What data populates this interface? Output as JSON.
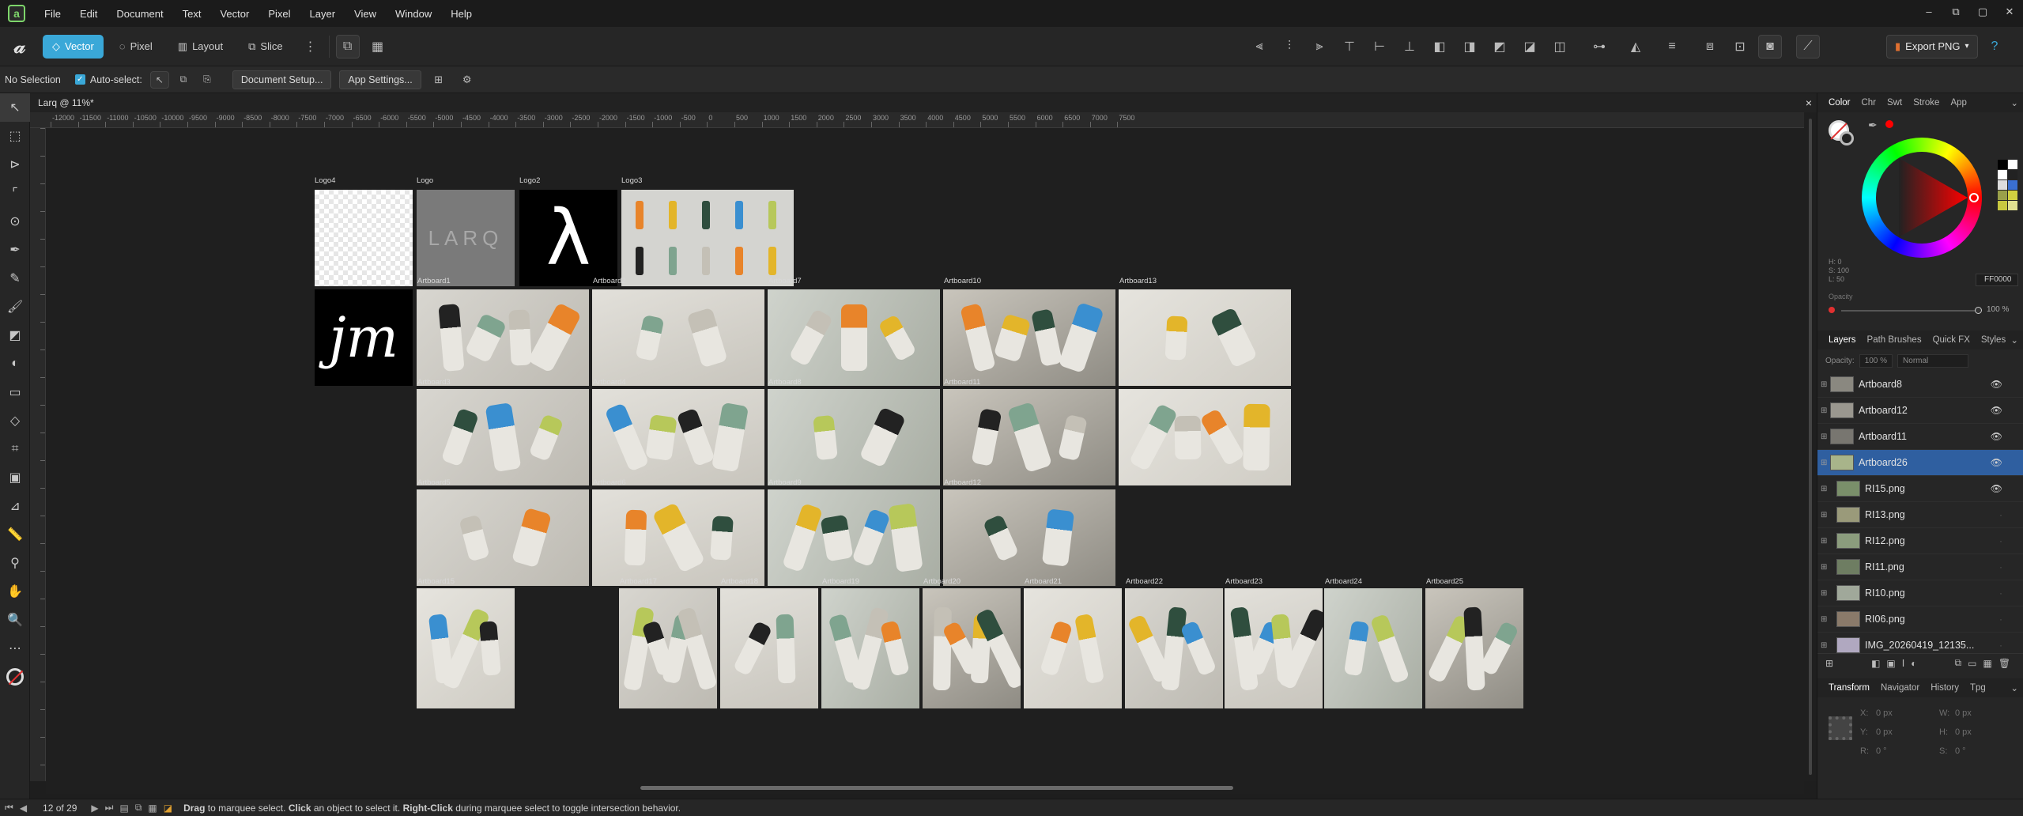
{
  "app": {
    "icon_letter": "a"
  },
  "menu": [
    "File",
    "Edit",
    "Document",
    "Text",
    "Vector",
    "Pixel",
    "Layer",
    "View",
    "Window",
    "Help"
  ],
  "window_controls": [
    "–",
    "⧉",
    "▢",
    "✕"
  ],
  "toolbar": {
    "personas": [
      {
        "label": "Vector",
        "active": true,
        "icon": "vector-persona-icon"
      },
      {
        "label": "Pixel",
        "active": false,
        "icon": "pixel-persona-icon"
      },
      {
        "label": "Layout",
        "active": false,
        "icon": "layout-persona-icon"
      },
      {
        "label": "Slice",
        "active": false,
        "icon": "slice-persona-icon"
      }
    ],
    "more": "⋮",
    "export_label": "Export PNG"
  },
  "context": {
    "selection": "No Selection",
    "autoselect_label": "Auto-select:",
    "document_setup": "Document Setup...",
    "app_settings": "App Settings..."
  },
  "document": {
    "tab_title": "Larq @ 11%*",
    "close": "×"
  },
  "ruler": {
    "h_labels": [
      "-12000",
      "-11500",
      "-11000",
      "-10500",
      "-10000",
      "-9500",
      "-9000",
      "-8500",
      "-8000",
      "-7500",
      "-7000",
      "-6500",
      "-6000",
      "-5500",
      "-5000",
      "-4500",
      "-4000",
      "-3500",
      "-3000",
      "-2500",
      "-2000",
      "-1500",
      "-1000",
      "-500",
      "0",
      "500",
      "1000",
      "1500",
      "2000",
      "2500",
      "3000",
      "3500",
      "4000",
      "4500",
      "5000",
      "5500",
      "6000",
      "6500",
      "7000",
      "7500"
    ]
  },
  "artboards": [
    {
      "label": "Logo4",
      "kind": "checker"
    },
    {
      "label": "Logo",
      "kind": "larq",
      "text": "LARQ"
    },
    {
      "label": "Logo2",
      "kind": "lambda",
      "text": "λ"
    },
    {
      "label": "Logo3",
      "kind": "grid"
    },
    {
      "label": "",
      "kind": "jm",
      "text": "jm"
    },
    {
      "label": "Artboard1",
      "kind": "photo"
    },
    {
      "label": "Artboard2",
      "kind": "photo"
    },
    {
      "label": "Artboard7",
      "kind": "photo"
    },
    {
      "label": "Artboard10",
      "kind": "photo"
    },
    {
      "label": "Artboard13",
      "kind": "photo"
    },
    {
      "label": "Artboard3",
      "kind": "photo"
    },
    {
      "label": "Artboard4",
      "kind": "photo"
    },
    {
      "label": "Artboard8",
      "kind": "photo"
    },
    {
      "label": "Artboard11",
      "kind": "photo"
    },
    {
      "label": "Artboard26",
      "kind": "photo"
    },
    {
      "label": "Artboard5",
      "kind": "photo"
    },
    {
      "label": "Artboard6",
      "kind": "photo"
    },
    {
      "label": "Artboard9",
      "kind": "photo"
    },
    {
      "label": "Artboard12",
      "kind": "photo"
    },
    {
      "label": "Artboard15",
      "kind": "photo"
    },
    {
      "label": "Artboard17",
      "kind": "photo"
    },
    {
      "label": "Artboard18",
      "kind": "photo"
    },
    {
      "label": "Artboard19",
      "kind": "photo"
    },
    {
      "label": "Artboard20",
      "kind": "photo"
    },
    {
      "label": "Artboard21",
      "kind": "photo"
    },
    {
      "label": "Artboard22",
      "kind": "photo"
    },
    {
      "label": "Artboard23",
      "kind": "photo"
    },
    {
      "label": "Artboard24",
      "kind": "photo"
    },
    {
      "label": "Artboard25",
      "kind": "photo"
    }
  ],
  "status": {
    "page": "12 of 29",
    "hint_parts": [
      {
        "t": "Drag",
        "b": true
      },
      {
        "t": " to marquee select. ",
        "b": false
      },
      {
        "t": "Click",
        "b": true
      },
      {
        "t": " an object to select it. ",
        "b": false
      },
      {
        "t": "Right-Click",
        "b": true
      },
      {
        "t": " during marquee select to toggle intersection behavior.",
        "b": false
      }
    ]
  },
  "color_panel": {
    "tabs": [
      "Color",
      "Chr",
      "Swt",
      "Stroke",
      "App"
    ],
    "h": "H: 0",
    "s": "S: 100",
    "l": "L: 50",
    "hex": "FF0000",
    "opacity_label": "Opacity",
    "opacity_value": "100 %",
    "accent": "#ff0000"
  },
  "layers_panel": {
    "tabs": [
      "Layers",
      "Path Brushes",
      "Quick FX",
      "Styles"
    ],
    "opacity_label": "Opacity:",
    "opacity": "100 %",
    "blend": "Normal",
    "items": [
      {
        "name": "Artboard8",
        "selected": false,
        "visible": true
      },
      {
        "name": "Artboard12",
        "selected": false,
        "visible": true
      },
      {
        "name": "Artboard11",
        "selected": false,
        "visible": true
      },
      {
        "name": "Artboard26",
        "selected": true,
        "visible": true
      },
      {
        "name": "RI15.png",
        "selected": false,
        "visible": true
      },
      {
        "name": "RI13.png",
        "selected": false,
        "visible": false
      },
      {
        "name": "RI12.png",
        "selected": false,
        "visible": false
      },
      {
        "name": "RI11.png",
        "selected": false,
        "visible": false
      },
      {
        "name": "RI10.png",
        "selected": false,
        "visible": false
      },
      {
        "name": "RI06.png",
        "selected": false,
        "visible": false
      },
      {
        "name": "IMG_20260419_12135...",
        "selected": false,
        "visible": false
      }
    ]
  },
  "transform_panel": {
    "tabs": [
      "Transform",
      "Navigator",
      "History",
      "Tpg"
    ],
    "x": "X:",
    "x_val": "0 px",
    "w": "W:",
    "w_val": "0 px",
    "y": "Y:",
    "y_val": "0 px",
    "h": "H:",
    "h_val": "0 px",
    "r": "R:",
    "r_val": "0 °",
    "s": "S:",
    "s_val": "0 °"
  }
}
